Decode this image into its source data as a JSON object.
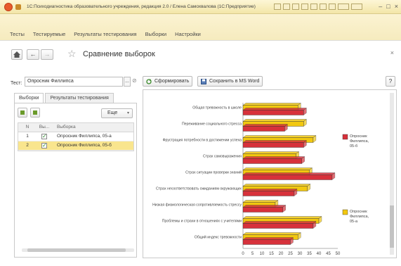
{
  "window": {
    "title": "1С:Психодиагностика образовательного учреждения, редакция 2.0 / Елена Самохвалова (1С:Предприятие)"
  },
  "menu": {
    "items": [
      "Тесты",
      "Тестируемые",
      "Результаты тестирования",
      "Выборки",
      "Настройки"
    ]
  },
  "header": {
    "home_icon": "home-icon",
    "back_label": "←",
    "forward_label": "→",
    "title": "Сравнение выборок",
    "close_label": "×"
  },
  "test_field": {
    "label": "Тест:",
    "value": "Опросник Филлипса",
    "dots_label": "...",
    "search_glyph": "⊘"
  },
  "buttons": {
    "form_label": "Сформировать",
    "save_label": "Сохранить в MS Word",
    "help_label": "?"
  },
  "tabs": [
    "Выборки",
    "Результаты тестирования"
  ],
  "panel": {
    "more_label": "Еще",
    "columns": [
      "N",
      "Вы...",
      "Выборка"
    ],
    "rows": [
      {
        "n": "1",
        "checked": "✓",
        "name": "Опросник Филлипса, 05-а"
      },
      {
        "n": "2",
        "checked": "✓",
        "name": "Опросник Филлипса, 05-б"
      }
    ]
  },
  "chart_data": {
    "type": "bar",
    "orientation": "horizontal",
    "categories": [
      "Общая тревожность в школе",
      "Переживание социального стресса",
      "Фрустрация потребности в достижении успеха",
      "Страх самовыражения",
      "Страх ситуации проверки знаний",
      "Страх несоответствовать ожиданиям окружающих",
      "Низкая физиологическая сопротивляемость стрессу",
      "Проблемы и страхи в отношениях с учителями",
      "Общий индекс тревожности"
    ],
    "series": [
      {
        "name": "Опросник Филлипса, 05-а",
        "color": "#f2c80f",
        "values": [
          29,
          32,
          37,
          28,
          35,
          34,
          17,
          40,
          29
        ]
      },
      {
        "name": "Опросник Филлипса, 05-б",
        "color": "#d7313b",
        "values": [
          32,
          22,
          32,
          31,
          47,
          27,
          21,
          37,
          25
        ]
      }
    ],
    "xticks": [
      "0",
      "5",
      "10",
      "15",
      "20",
      "25",
      "30",
      "35",
      "40",
      "45",
      "50"
    ],
    "xlim": [
      0,
      50
    ],
    "legend_position": "right",
    "grid": false
  }
}
